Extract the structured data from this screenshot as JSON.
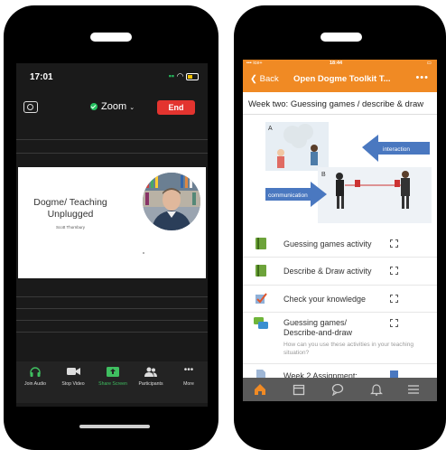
{
  "zoom": {
    "status_time": "17:01",
    "title": "Zoom",
    "end_label": "End",
    "slide": {
      "title": "Dogme/ Teaching Unplugged",
      "author": "Scott Thornbury"
    },
    "toolbar": [
      {
        "label": "Join Audio",
        "icon": "headphones-icon",
        "active": false
      },
      {
        "label": "Stop Video",
        "icon": "video-camera-icon",
        "active": false
      },
      {
        "label": "Share Screen",
        "icon": "share-screen-icon",
        "active": true
      },
      {
        "label": "Participants",
        "icon": "participants-icon",
        "active": false
      },
      {
        "label": "More",
        "icon": "more-dots-icon",
        "active": false
      }
    ],
    "colors": {
      "end": "#e3342f",
      "active": "#3fbf60"
    }
  },
  "lms": {
    "status_carrier": "ice+",
    "status_time": "18:44",
    "back_label": "Back",
    "title": "Open Dogme Toolkit T...",
    "week_title": "Week two: Guessing games / describe & draw",
    "illustration": {
      "label_a": "A",
      "label_b": "B",
      "interaction": "interaction",
      "communication": "communication"
    },
    "activities": [
      {
        "label": "Guessing games activity",
        "icon": "book-icon",
        "checked": false
      },
      {
        "label": "Describe & Draw activity",
        "icon": "book-icon",
        "checked": false
      },
      {
        "label": "Check your knowledge",
        "icon": "quiz-icon",
        "checked": false
      },
      {
        "label": "Guessing games/ Describe-and-draw",
        "sub": "How can you use these activities in your teaching situation?",
        "icon": "forum-icon",
        "checked": false
      },
      {
        "label": "Week 2 Assignment:",
        "icon": "assignment-icon",
        "checked": true
      }
    ],
    "tabs": [
      "home-icon",
      "calendar-icon",
      "messages-icon",
      "notifications-icon",
      "menu-icon"
    ],
    "colors": {
      "accent": "#f08a24",
      "tabbar": "#5a5a5a"
    }
  }
}
